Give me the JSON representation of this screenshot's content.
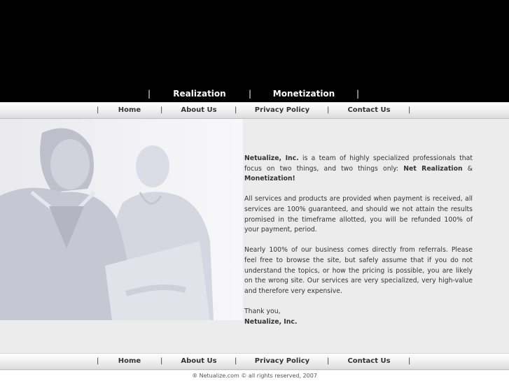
{
  "top_nav": {
    "items": [
      {
        "label": "Realization"
      },
      {
        "label": "Monetization"
      }
    ],
    "separator": "|"
  },
  "main_nav": {
    "items": [
      {
        "label": "Home"
      },
      {
        "label": "About Us"
      },
      {
        "label": "Privacy Policy"
      },
      {
        "label": "Contact Us"
      }
    ],
    "separator": "|"
  },
  "content": {
    "p1_company": "Netualize, Inc.",
    "p1_text_a": " is a team of highly specialized professionals that focus on two things, and two things only: ",
    "p1_term1": "Net Realization",
    "p1_amp": " & ",
    "p1_term2": "Monetization!",
    "p2": "All services and products are provided when payment is received, all services are 100% guaranteed, and should we not attain the results promised in the timeframe allotted, you will be refunded 100% of your payment, period.",
    "p3": "Nearly 100% of our business comes directly from referrals. Please feel free to browse the site, but safely assume that if you do not understand the topics, or how the pricing is possible, you are likely on the wrong site. Our services are very specialized, very high-value and therefore very expensive.",
    "thanks": "Thank you,",
    "signature": "Netualize, Inc."
  },
  "footer": {
    "text": "® Netualize.com © all rights reserved, 2007"
  },
  "colors": {
    "header_bg": "#000000",
    "page_bg": "#ececec",
    "text": "#333333"
  }
}
